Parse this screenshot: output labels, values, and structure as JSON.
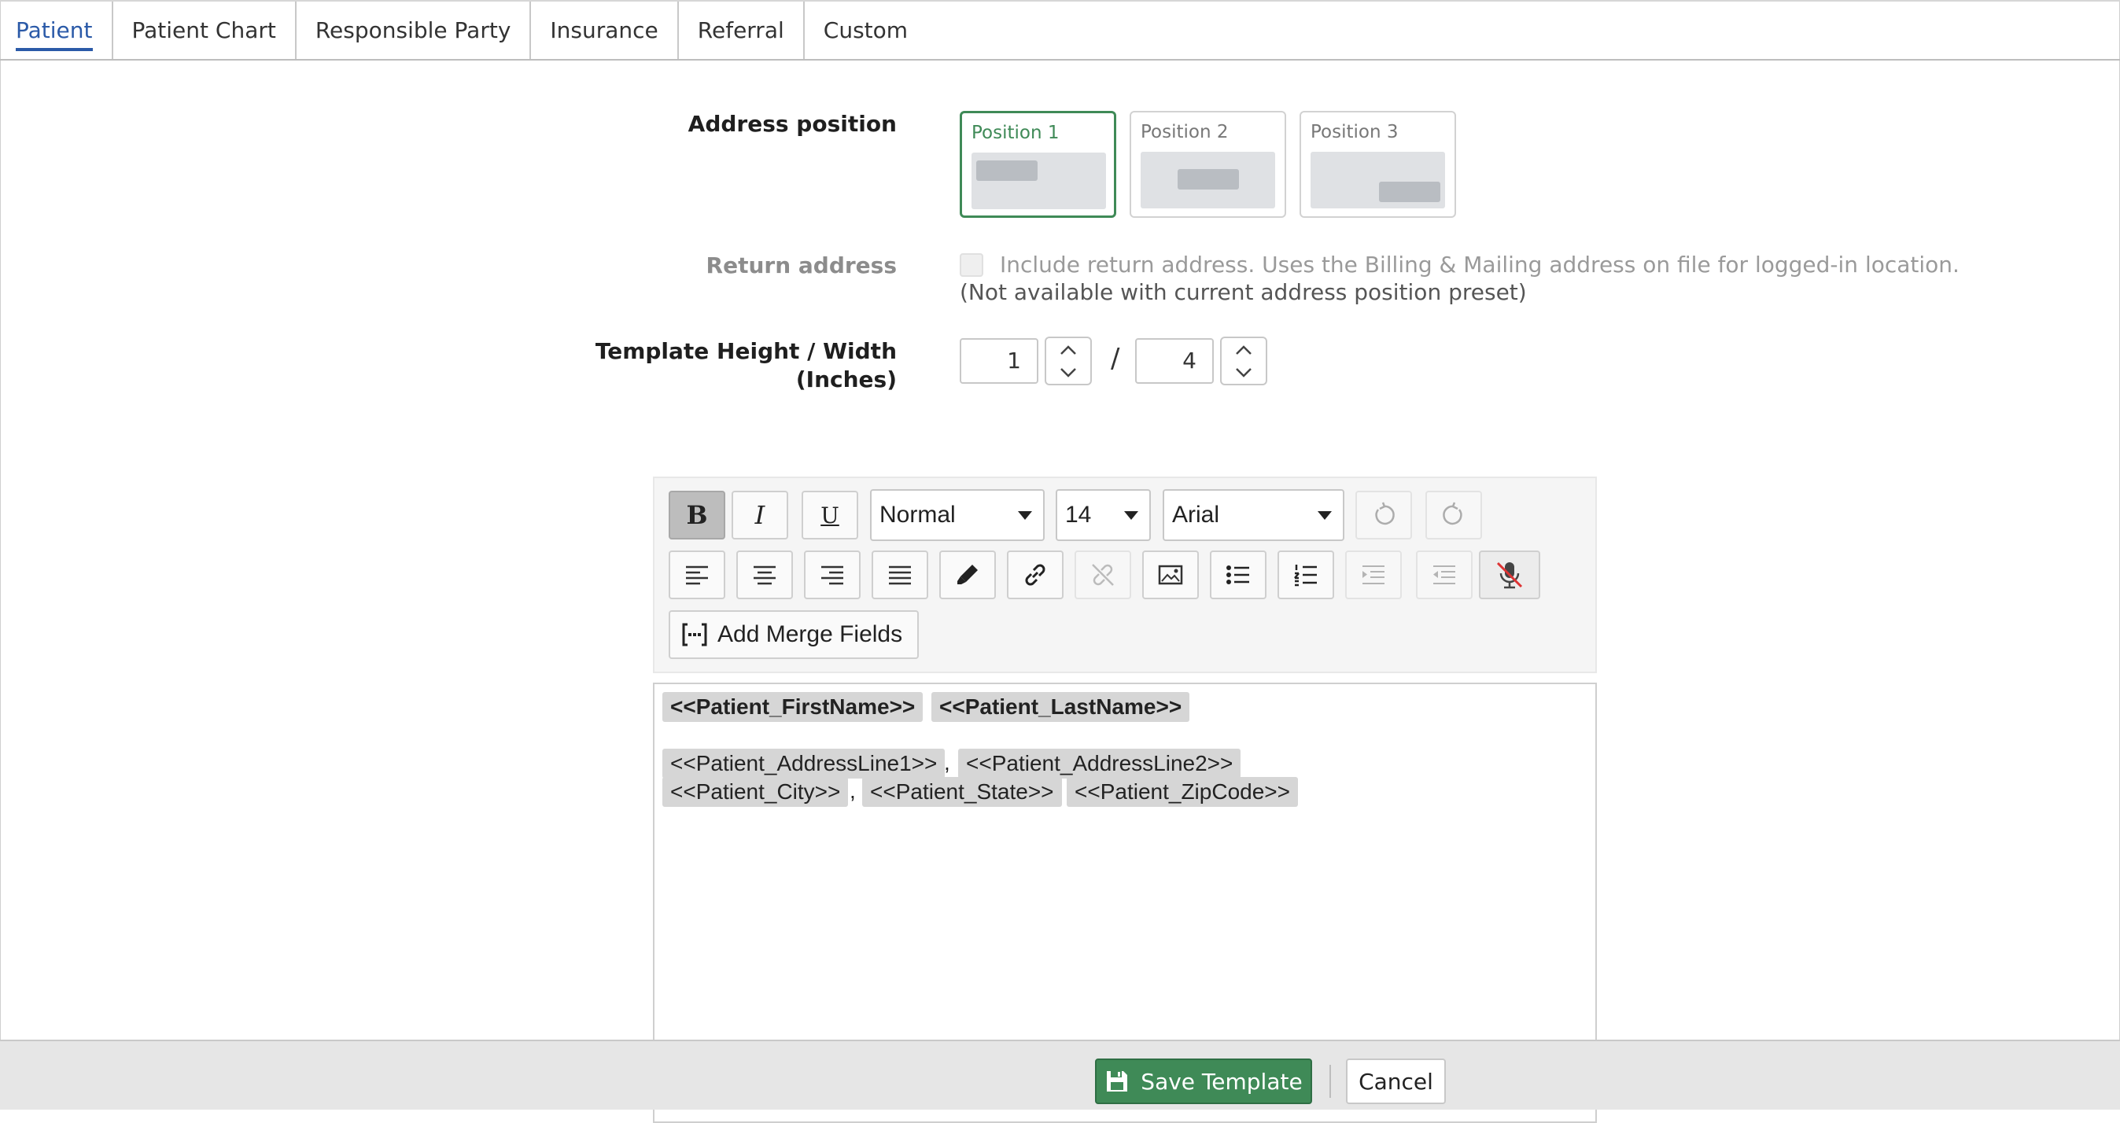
{
  "tabs": [
    "Patient",
    "Patient Chart",
    "Responsible Party",
    "Insurance",
    "Referral",
    "Custom"
  ],
  "active_tab": "Patient",
  "address_position": {
    "label": "Address position",
    "options": [
      "Position 1",
      "Position 2",
      "Position 3"
    ],
    "selected": "Position 1"
  },
  "return_address": {
    "label": "Return address",
    "checkbox_text": "Include return address. Uses the Billing & Mailing address on file for logged-in location.",
    "note": "(Not available with current address position preset)",
    "checked": false,
    "disabled": true
  },
  "template_size": {
    "label_line1": "Template Height / Width",
    "label_line2": "(Inches)",
    "height": "1",
    "width": "4",
    "separator": "/"
  },
  "toolbar": {
    "bold_label": "B",
    "italic_label": "I",
    "underline_label": "U",
    "style_value": "Normal",
    "size_value": "14",
    "font_value": "Arial",
    "merge_fields_label": "Add Merge Fields",
    "icons": [
      "bold-icon",
      "italic-icon",
      "underline-icon",
      "undo-icon",
      "redo-icon",
      "align-left-icon",
      "align-center-icon",
      "align-right-icon",
      "align-justify-icon",
      "highlight-icon",
      "link-icon",
      "unlink-icon",
      "image-icon",
      "bullet-list-icon",
      "numbered-list-icon",
      "indent-icon",
      "outdent-icon",
      "microphone-off-icon",
      "merge-fields-icon"
    ]
  },
  "editor": {
    "line1": [
      "<<Patient_FirstName>>",
      "<<Patient_LastName>>"
    ],
    "line2": [
      "<<Patient_AddressLine1>>",
      "<<Patient_AddressLine2>>"
    ],
    "line3": [
      "<<Patient_City>>",
      "<<Patient_State>>",
      "<<Patient_ZipCode>>"
    ],
    "comma": ","
  },
  "footer": {
    "save_label": "Save Template",
    "cancel_label": "Cancel"
  },
  "colors": {
    "accent_blue": "#2b5aa8",
    "accent_green": "#3f8a57"
  }
}
